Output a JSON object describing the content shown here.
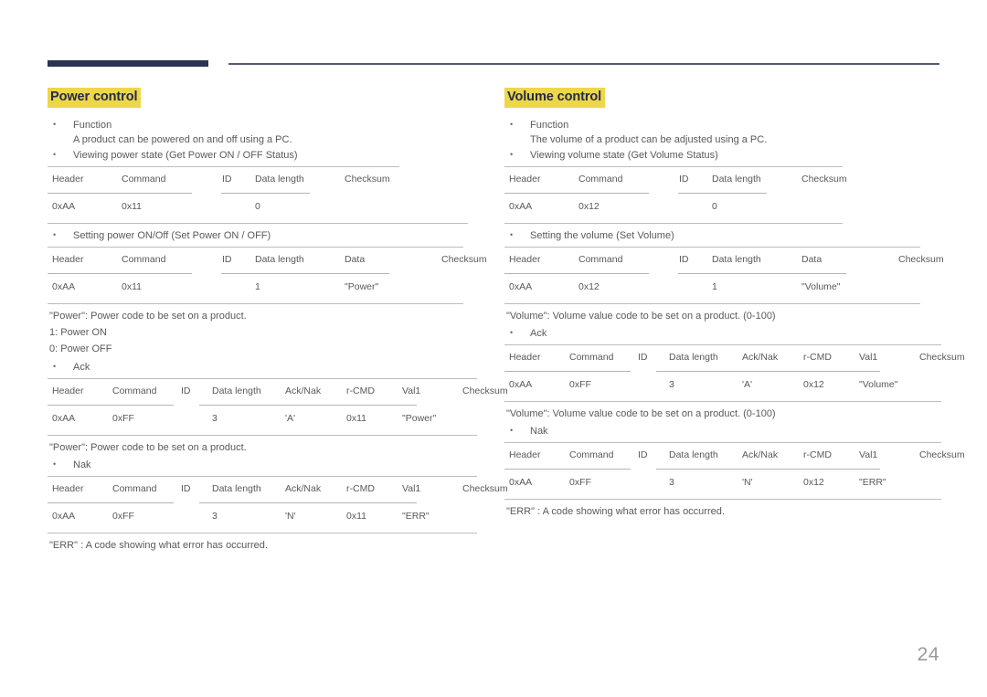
{
  "page": {
    "number": "24"
  },
  "columns": {
    "left": {
      "title": "Power control",
      "function_label": "Function",
      "function_text": "A product can be powered on and off using a PC.",
      "get_status_label": "Viewing power state (Get Power ON / OFF Status)",
      "get_status_table": {
        "headers": [
          "Header",
          "Command",
          "ID",
          "Data length",
          "Checksum"
        ],
        "values": [
          "0xAA",
          "0x11",
          "",
          "0",
          ""
        ]
      },
      "set_label": "Setting power ON/Off (Set Power ON / OFF)",
      "set_table": {
        "headers": [
          "Header",
          "Command",
          "ID",
          "Data length",
          "Data",
          "Checksum"
        ],
        "values": [
          "0xAA",
          "0x11",
          "",
          "1",
          "\"Power\"",
          ""
        ]
      },
      "set_note": "\"Power\": Power code to be set on a product.",
      "set_note_on": "1: Power ON",
      "set_note_off": "0: Power OFF",
      "ack_label": "Ack",
      "ack_table": {
        "headers": [
          "Header",
          "Command",
          "ID",
          "Data length",
          "Ack/Nak",
          "r-CMD",
          "Val1",
          "Checksum"
        ],
        "values": [
          "0xAA",
          "0xFF",
          "",
          "3",
          "'A'",
          "0x11",
          "\"Power\"",
          ""
        ]
      },
      "ack_note": "\"Power\": Power code to be set on a product.",
      "nak_label": "Nak",
      "nak_table": {
        "headers": [
          "Header",
          "Command",
          "ID",
          "Data length",
          "Ack/Nak",
          "r-CMD",
          "Val1",
          "Checksum"
        ],
        "values": [
          "0xAA",
          "0xFF",
          "",
          "3",
          "'N'",
          "0x11",
          "\"ERR\"",
          ""
        ]
      },
      "nak_note": "\"ERR\" : A code showing what error has occurred."
    },
    "right": {
      "title": "Volume control",
      "function_label": "Function",
      "function_text": "The volume of a product can be adjusted using a PC.",
      "get_status_label": "Viewing volume state (Get Volume Status)",
      "get_status_table": {
        "headers": [
          "Header",
          "Command",
          "ID",
          "Data length",
          "Checksum"
        ],
        "values": [
          "0xAA",
          "0x12",
          "",
          "0",
          ""
        ]
      },
      "set_label": "Setting the volume (Set Volume)",
      "set_table": {
        "headers": [
          "Header",
          "Command",
          "ID",
          "Data length",
          "Data",
          "Checksum"
        ],
        "values": [
          "0xAA",
          "0x12",
          "",
          "1",
          "\"Volume\"",
          ""
        ]
      },
      "set_note": "\"Volume\": Volume value code to be set on a product. (0-100)",
      "ack_label": "Ack",
      "ack_table": {
        "headers": [
          "Header",
          "Command",
          "ID",
          "Data length",
          "Ack/Nak",
          "r-CMD",
          "Val1",
          "Checksum"
        ],
        "values": [
          "0xAA",
          "0xFF",
          "",
          "3",
          "'A'",
          "0x12",
          "\"Volume\"",
          ""
        ]
      },
      "ack_note": "\"Volume\": Volume value code to be set on a product. (0-100)",
      "nak_label": "Nak",
      "nak_table": {
        "headers": [
          "Header",
          "Command",
          "ID",
          "Data length",
          "Ack/Nak",
          "r-CMD",
          "Val1",
          "Checksum"
        ],
        "values": [
          "0xAA",
          "0xFF",
          "",
          "3",
          "'N'",
          "0x12",
          "\"ERR\"",
          ""
        ]
      },
      "nak_note": "\"ERR\" : A code showing what error has occurred."
    }
  },
  "colors": {
    "highlight": "#eed64b",
    "heading_text": "#222b45",
    "header_bar": "#2b3452",
    "rule": "#bdbdbd"
  }
}
